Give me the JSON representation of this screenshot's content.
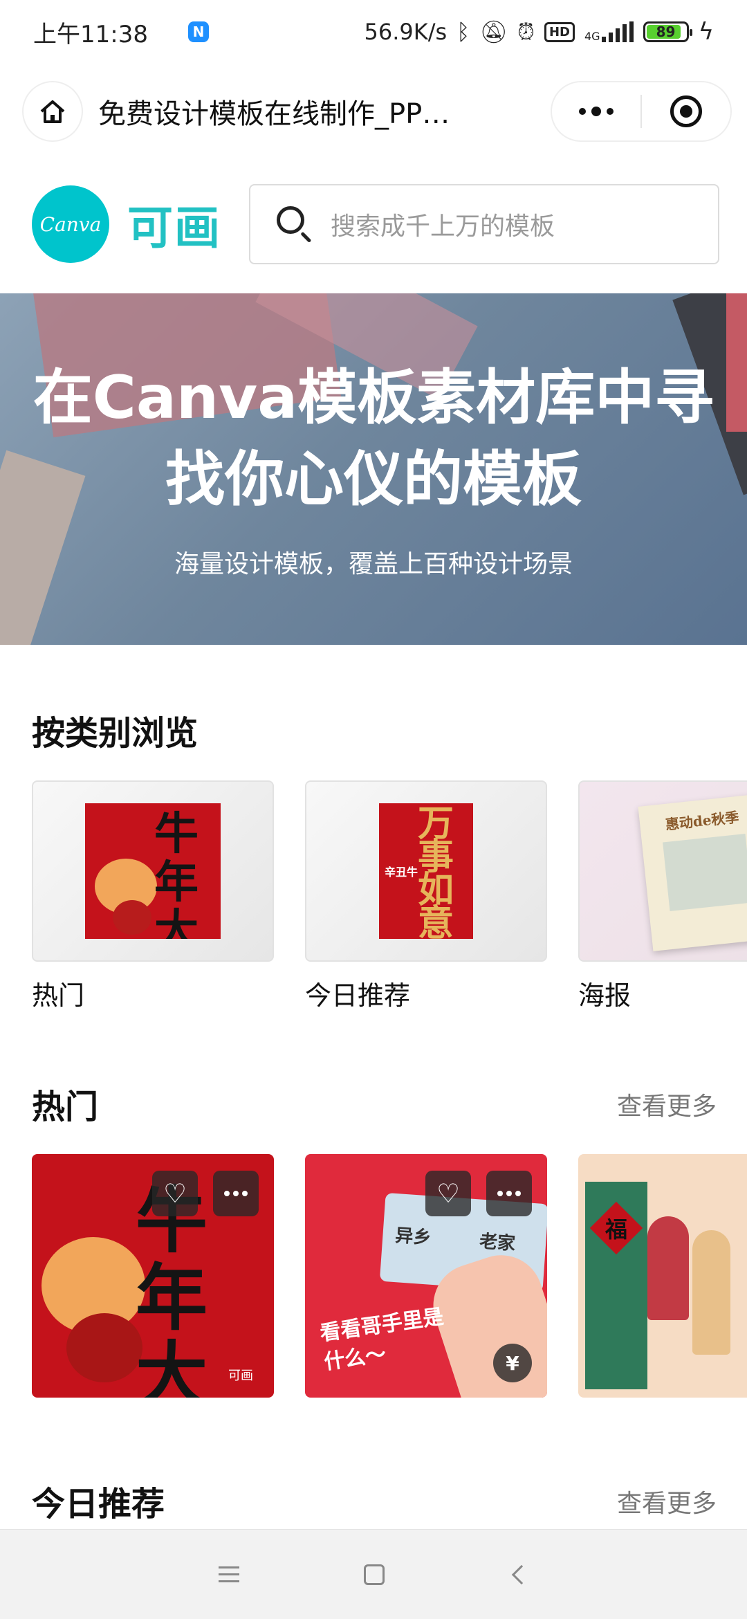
{
  "status_bar": {
    "time": "上午11:38",
    "app_badge": "N",
    "net_speed": "56.9K/s",
    "hd": "HD",
    "network_type": "4G",
    "battery_level": 89,
    "battery_text": "89"
  },
  "title_bar": {
    "title": "免费设计模板在线制作_PP…"
  },
  "brand": {
    "canva_logo_text": "Canva",
    "kehua_logo_text": "可画"
  },
  "search": {
    "placeholder": "搜索成千上万的模板"
  },
  "hero": {
    "title": "在Canva模板素材库中寻找你心仪的模板",
    "subtitle": "海量设计模板，覆盖上百种设计场景"
  },
  "browse": {
    "heading": "按类别浏览",
    "categories": [
      {
        "label": "热门",
        "art_text": "牛年大吉"
      },
      {
        "label": "今日推荐",
        "art_text": "万事如意",
        "art_subtext": "辛丑牛"
      },
      {
        "label": "海报",
        "art_text": "惠动de秋季"
      }
    ]
  },
  "hot": {
    "heading": "热门",
    "see_more": "查看更多",
    "cards": [
      {
        "art_text": "牛年大吉",
        "brand_mark": "可画"
      },
      {
        "art_text_1": "异乡",
        "art_text_2": "老家",
        "art_caption": "看看哥手里是什么～",
        "price_symbol": "¥"
      },
      {
        "art_text": "福"
      }
    ]
  },
  "today": {
    "heading": "今日推荐",
    "see_more": "查看更多"
  },
  "colors": {
    "canva_brand": "#00c4cc",
    "card_red": "#c4121b",
    "card_pink_red": "#e02a3c",
    "battery_green": "#58d02f"
  }
}
